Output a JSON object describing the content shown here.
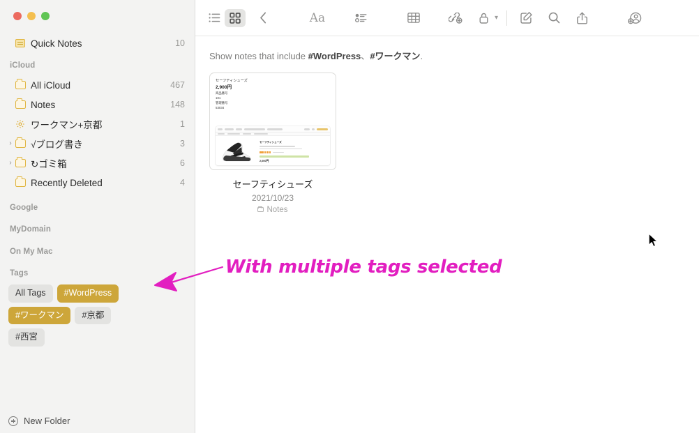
{
  "window": {
    "traffic_lights": [
      "close-red",
      "minimize-yellow",
      "zoom-green"
    ]
  },
  "sidebar": {
    "quick_notes": {
      "label": "Quick Notes",
      "count": "10",
      "icon": "quick-note-icon"
    },
    "sections": [
      {
        "header": "iCloud",
        "items": [
          {
            "label": "All iCloud",
            "count": "467",
            "icon": "folder-icon",
            "twisty": ""
          },
          {
            "label": "Notes",
            "count": "148",
            "icon": "folder-icon",
            "twisty": ""
          },
          {
            "label": "ワークマン+京都",
            "count": "1",
            "icon": "gear-icon",
            "twisty": ""
          },
          {
            "label": "√ブログ書き",
            "count": "3",
            "icon": "folder-icon",
            "twisty": "›"
          },
          {
            "label": "↻ゴミ箱",
            "count": "6",
            "icon": "folder-icon",
            "twisty": "›"
          },
          {
            "label": "Recently Deleted",
            "count": "4",
            "icon": "folder-icon",
            "twisty": ""
          }
        ]
      },
      {
        "header": "Google",
        "items": []
      },
      {
        "header": "MyDomain",
        "items": []
      },
      {
        "header": "On My Mac",
        "items": []
      }
    ],
    "tags_header": "Tags",
    "tags": [
      {
        "label": "All Tags",
        "selected": false
      },
      {
        "label": "#WordPress",
        "selected": true
      },
      {
        "label": "#ワークマン",
        "selected": true
      },
      {
        "label": "#京都",
        "selected": false
      },
      {
        "label": "#西宮",
        "selected": false
      }
    ],
    "new_folder_label": "New Folder",
    "colors": {
      "tag_selected_bg": "#cda63a",
      "tag_bg": "#e3e3e1",
      "folder_accent": "#e0b53f"
    }
  },
  "toolbar": {
    "items": [
      {
        "name": "list-view-icon",
        "active": false
      },
      {
        "name": "grid-view-icon",
        "active": true
      },
      {
        "name": "back-chevron-icon",
        "active": false
      },
      {
        "name": "format-aa-icon",
        "label": "Aa",
        "active": false
      },
      {
        "name": "checklist-icon",
        "active": false
      },
      {
        "name": "table-icon",
        "active": false
      },
      {
        "name": "add-link-icon",
        "active": false
      },
      {
        "name": "lock-icon",
        "active": false
      },
      {
        "name": "compose-note-icon",
        "active": false
      },
      {
        "name": "search-icon",
        "active": false
      },
      {
        "name": "share-icon",
        "active": false
      },
      {
        "name": "add-collaborator-icon",
        "active": false
      }
    ]
  },
  "main": {
    "filter": {
      "prefix": "Show notes that include ",
      "tag1": "#WordPress",
      "separator": "、",
      "tag2": "#ワークマン",
      "suffix": "."
    },
    "note_card": {
      "preview": {
        "title": "セーフティシューズ",
        "price": "2,900円",
        "line1_label": "商品番号",
        "line1_value": "101",
        "line2_label": "管理番号",
        "line2_value": "53034",
        "embedded_product_title": "セーフティシューズ",
        "embedded_price": "2,000円"
      },
      "title": "セーフティシューズ",
      "date": "2021/10/23",
      "folder": "Notes"
    }
  },
  "annotation": {
    "text": "With multiple tags selected",
    "color": "#e21ec0",
    "arrow": "left-arrow-annotation"
  }
}
